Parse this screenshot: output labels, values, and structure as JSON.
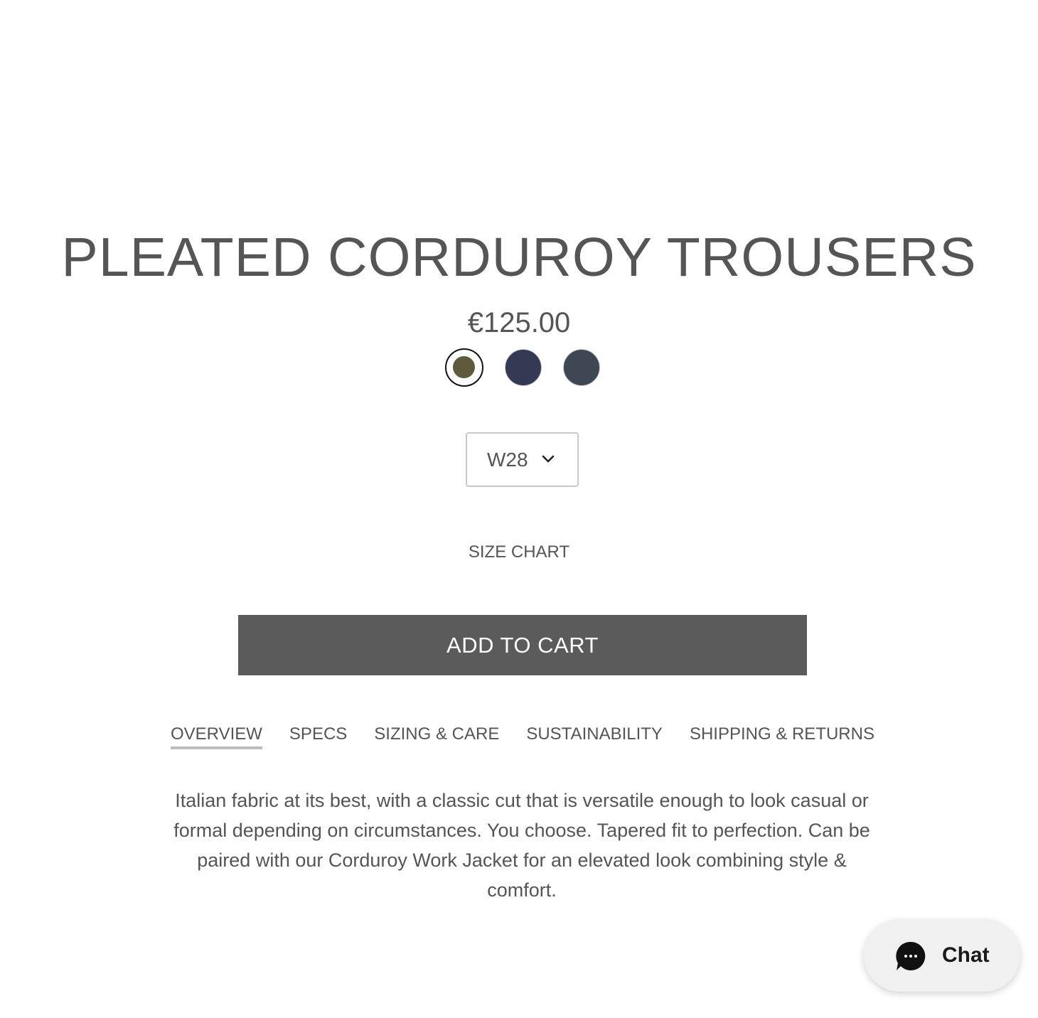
{
  "product": {
    "title": "PLEATED CORDUROY TROUSERS",
    "price": "€125.00"
  },
  "swatches": [
    {
      "name": "olive",
      "color": "#5f5a3d",
      "selected": true
    },
    {
      "name": "navy",
      "color": "#343954",
      "selected": false
    },
    {
      "name": "charcoal",
      "color": "#3f4654",
      "selected": false
    }
  ],
  "size_select": {
    "value": "W28",
    "icon": "chevron-down-icon"
  },
  "size_chart_label": "SIZE CHART",
  "cta": {
    "add_to_cart_label": "ADD TO CART",
    "color": "#5b5b5b"
  },
  "tabs": [
    {
      "label": "OVERVIEW",
      "active": true
    },
    {
      "label": "SPECS",
      "active": false
    },
    {
      "label": "SIZING & CARE",
      "active": false
    },
    {
      "label": "SUSTAINABILITY",
      "active": false
    },
    {
      "label": "SHIPPING & RETURNS",
      "active": false
    }
  ],
  "overview_text": "Italian fabric at its best, with a classic cut that is versatile enough to look casual or formal depending on circumstances. You choose. Tapered fit to perfection. Can be paired with our Corduroy Work Jacket for an elevated look combining style & comfort.",
  "chat": {
    "label": "Chat",
    "icon": "chat-bubble-icon"
  }
}
